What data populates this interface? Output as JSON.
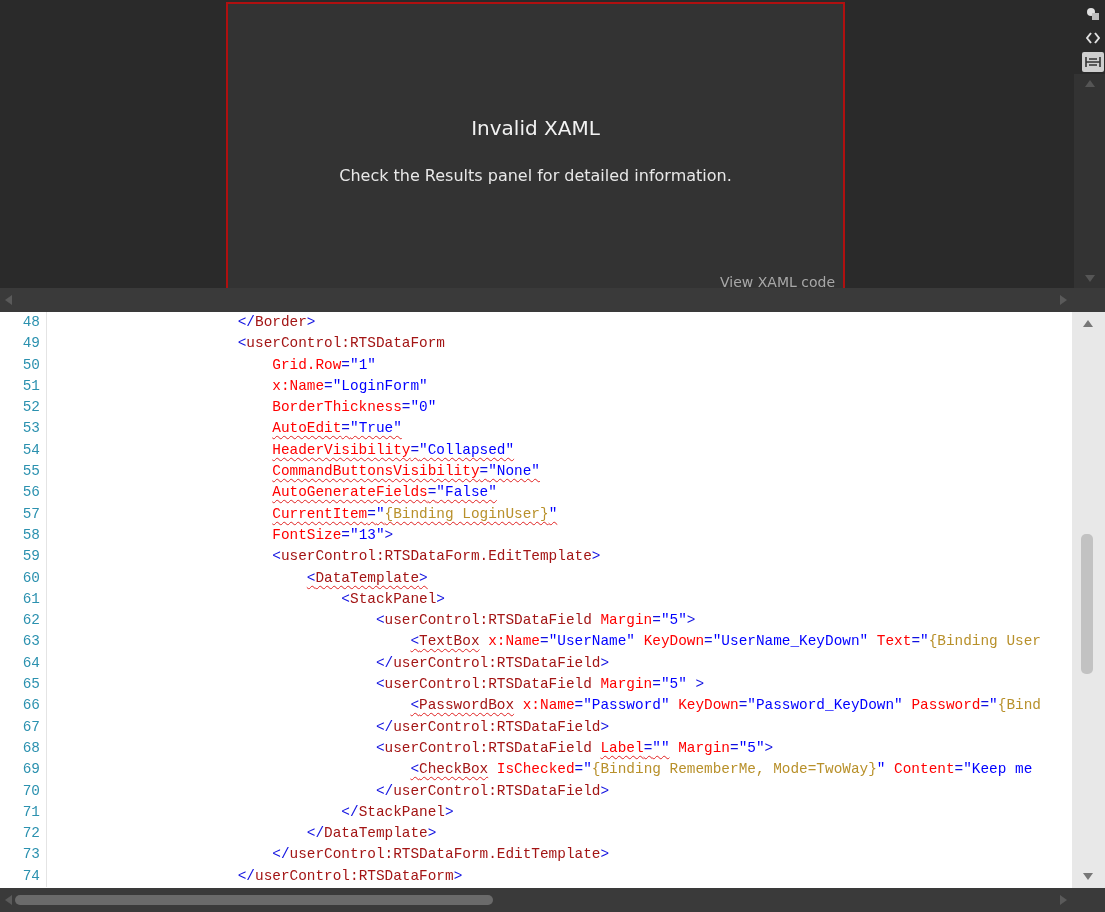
{
  "designer": {
    "title": "Invalid XAML",
    "detail": "Check the Results panel for detailed information.",
    "link": "View XAML code"
  },
  "toolbar": [
    {
      "kind": "layers",
      "selected": false
    },
    {
      "kind": "code",
      "selected": false
    },
    {
      "kind": "ruler",
      "selected": true
    }
  ],
  "editor": {
    "lines": [
      {
        "number": "48",
        "tokens": [
          {
            "kind": "punct",
            "text": "                    </",
            "error": false
          },
          {
            "kind": "element",
            "text": "Border",
            "error": false
          },
          {
            "kind": "punct",
            "text": ">",
            "error": false
          }
        ]
      },
      {
        "number": "49",
        "tokens": [
          {
            "kind": "punct",
            "text": "                    <",
            "error": false
          },
          {
            "kind": "element",
            "text": "userControl:RTSDataForm",
            "error": false
          }
        ]
      },
      {
        "number": "50",
        "tokens": [
          {
            "kind": "attribute",
            "text": "                        Grid.Row",
            "error": false
          },
          {
            "kind": "punct",
            "text": "=",
            "error": false
          },
          {
            "kind": "value",
            "text": "\"1\"",
            "error": false
          }
        ]
      },
      {
        "number": "51",
        "tokens": [
          {
            "kind": "attribute",
            "text": "                        x:Name",
            "error": false
          },
          {
            "kind": "punct",
            "text": "=",
            "error": false
          },
          {
            "kind": "value",
            "text": "\"LoginForm\"",
            "error": false
          }
        ]
      },
      {
        "number": "52",
        "tokens": [
          {
            "kind": "attribute",
            "text": "                        BorderThickness",
            "error": false
          },
          {
            "kind": "punct",
            "text": "=",
            "error": false
          },
          {
            "kind": "value",
            "text": "\"0\"",
            "error": false
          }
        ]
      },
      {
        "number": "53",
        "tokens": [
          {
            "kind": "attribute",
            "text": "                        AutoEdit",
            "error": true
          },
          {
            "kind": "punct",
            "text": "=",
            "error": true
          },
          {
            "kind": "value",
            "text": "\"True\"",
            "error": true
          }
        ]
      },
      {
        "number": "54",
        "tokens": [
          {
            "kind": "attribute",
            "text": "                        HeaderVisibility",
            "error": true
          },
          {
            "kind": "punct",
            "text": "=",
            "error": true
          },
          {
            "kind": "value",
            "text": "\"Collapsed\"",
            "error": true
          }
        ]
      },
      {
        "number": "55",
        "tokens": [
          {
            "kind": "attribute",
            "text": "                        CommandButtonsVisibility",
            "error": true
          },
          {
            "kind": "punct",
            "text": "=",
            "error": true
          },
          {
            "kind": "value",
            "text": "\"None\"",
            "error": true
          }
        ]
      },
      {
        "number": "56",
        "tokens": [
          {
            "kind": "attribute",
            "text": "                        AutoGenerateFields",
            "error": true
          },
          {
            "kind": "punct",
            "text": "=",
            "error": true
          },
          {
            "kind": "value",
            "text": "\"False\"",
            "error": true
          }
        ]
      },
      {
        "number": "57",
        "tokens": [
          {
            "kind": "attribute",
            "text": "                        CurrentItem",
            "error": true
          },
          {
            "kind": "punct",
            "text": "=",
            "error": true
          },
          {
            "kind": "value",
            "text": "\"",
            "error": true
          },
          {
            "kind": "binding",
            "text": "{Binding LoginUser}",
            "error": true
          },
          {
            "kind": "value",
            "text": "\"",
            "error": true
          }
        ]
      },
      {
        "number": "58",
        "tokens": [
          {
            "kind": "attribute",
            "text": "                        FontSize",
            "error": false
          },
          {
            "kind": "punct",
            "text": "=",
            "error": false
          },
          {
            "kind": "value",
            "text": "\"13\"",
            "error": false
          },
          {
            "kind": "punct",
            "text": ">",
            "error": false
          }
        ]
      },
      {
        "number": "59",
        "tokens": [
          {
            "kind": "punct",
            "text": "                        <",
            "error": false
          },
          {
            "kind": "element",
            "text": "userControl:RTSDataForm.EditTemplate",
            "error": false
          },
          {
            "kind": "punct",
            "text": ">",
            "error": false
          }
        ]
      },
      {
        "number": "60",
        "tokens": [
          {
            "kind": "punct",
            "text": "                            <",
            "error": true
          },
          {
            "kind": "element",
            "text": "DataTemplate",
            "error": true
          },
          {
            "kind": "punct",
            "text": ">",
            "error": true
          }
        ]
      },
      {
        "number": "61",
        "tokens": [
          {
            "kind": "punct",
            "text": "                                <",
            "error": false
          },
          {
            "kind": "element",
            "text": "StackPanel",
            "error": false
          },
          {
            "kind": "punct",
            "text": ">",
            "error": false
          }
        ]
      },
      {
        "number": "62",
        "tokens": [
          {
            "kind": "punct",
            "text": "                                    <",
            "error": false
          },
          {
            "kind": "element",
            "text": "userControl:RTSDataField",
            "error": false
          },
          {
            "kind": "attribute",
            "text": " Margin",
            "error": false
          },
          {
            "kind": "punct",
            "text": "=",
            "error": false
          },
          {
            "kind": "value",
            "text": "\"5\"",
            "error": false
          },
          {
            "kind": "punct",
            "text": ">",
            "error": false
          }
        ]
      },
      {
        "number": "63",
        "tokens": [
          {
            "kind": "punct",
            "text": "                                        <",
            "error": true
          },
          {
            "kind": "element",
            "text": "TextBox",
            "error": true
          },
          {
            "kind": "attribute",
            "text": " x:Name",
            "error": false
          },
          {
            "kind": "punct",
            "text": "=",
            "error": false
          },
          {
            "kind": "value",
            "text": "\"UserName\"",
            "error": false
          },
          {
            "kind": "attribute",
            "text": " KeyDown",
            "error": false
          },
          {
            "kind": "punct",
            "text": "=",
            "error": false
          },
          {
            "kind": "value",
            "text": "\"UserName_KeyDown\"",
            "error": false
          },
          {
            "kind": "attribute",
            "text": " Text",
            "error": false
          },
          {
            "kind": "punct",
            "text": "=",
            "error": false
          },
          {
            "kind": "value",
            "text": "\"",
            "error": false
          },
          {
            "kind": "binding",
            "text": "{Binding User",
            "error": false
          }
        ]
      },
      {
        "number": "64",
        "tokens": [
          {
            "kind": "punct",
            "text": "                                    </",
            "error": false
          },
          {
            "kind": "element",
            "text": "userControl:RTSDataField",
            "error": false
          },
          {
            "kind": "punct",
            "text": ">",
            "error": false
          }
        ]
      },
      {
        "number": "65",
        "tokens": [
          {
            "kind": "punct",
            "text": "                                    <",
            "error": false
          },
          {
            "kind": "element",
            "text": "userControl:RTSDataField",
            "error": false
          },
          {
            "kind": "attribute",
            "text": " Margin",
            "error": false
          },
          {
            "kind": "punct",
            "text": "=",
            "error": false
          },
          {
            "kind": "value",
            "text": "\"5\"",
            "error": false
          },
          {
            "kind": "punct",
            "text": " >",
            "error": false
          }
        ]
      },
      {
        "number": "66",
        "tokens": [
          {
            "kind": "punct",
            "text": "                                        <",
            "error": true
          },
          {
            "kind": "element",
            "text": "PasswordBox",
            "error": true
          },
          {
            "kind": "attribute",
            "text": " x:Name",
            "error": false
          },
          {
            "kind": "punct",
            "text": "=",
            "error": false
          },
          {
            "kind": "value",
            "text": "\"Password\"",
            "error": false
          },
          {
            "kind": "attribute",
            "text": " KeyDown",
            "error": false
          },
          {
            "kind": "punct",
            "text": "=",
            "error": false
          },
          {
            "kind": "value",
            "text": "\"Password_KeyDown\"",
            "error": false
          },
          {
            "kind": "attribute",
            "text": " Password",
            "error": false
          },
          {
            "kind": "punct",
            "text": "=",
            "error": false
          },
          {
            "kind": "value",
            "text": "\"",
            "error": false
          },
          {
            "kind": "binding",
            "text": "{Bind",
            "error": false
          }
        ]
      },
      {
        "number": "67",
        "tokens": [
          {
            "kind": "punct",
            "text": "                                    </",
            "error": false
          },
          {
            "kind": "element",
            "text": "userControl:RTSDataField",
            "error": false
          },
          {
            "kind": "punct",
            "text": ">",
            "error": false
          }
        ]
      },
      {
        "number": "68",
        "tokens": [
          {
            "kind": "punct",
            "text": "                                    <",
            "error": false
          },
          {
            "kind": "element",
            "text": "userControl:RTSDataField ",
            "error": false
          },
          {
            "kind": "attribute",
            "text": "Label",
            "error": true
          },
          {
            "kind": "punct",
            "text": "=",
            "error": true
          },
          {
            "kind": "value",
            "text": "\"\"",
            "error": true
          },
          {
            "kind": "attribute",
            "text": " Margin",
            "error": false
          },
          {
            "kind": "punct",
            "text": "=",
            "error": false
          },
          {
            "kind": "value",
            "text": "\"5\"",
            "error": false
          },
          {
            "kind": "punct",
            "text": ">",
            "error": false
          }
        ]
      },
      {
        "number": "69",
        "tokens": [
          {
            "kind": "punct",
            "text": "                                        <",
            "error": true
          },
          {
            "kind": "element",
            "text": "CheckBox",
            "error": true
          },
          {
            "kind": "attribute",
            "text": " IsChecked",
            "error": false
          },
          {
            "kind": "punct",
            "text": "=",
            "error": false
          },
          {
            "kind": "value",
            "text": "\"",
            "error": false
          },
          {
            "kind": "binding",
            "text": "{Binding RememberMe, Mode=TwoWay}",
            "error": false
          },
          {
            "kind": "value",
            "text": "\"",
            "error": false
          },
          {
            "kind": "attribute",
            "text": " Content",
            "error": false
          },
          {
            "kind": "punct",
            "text": "=",
            "error": false
          },
          {
            "kind": "value",
            "text": "\"Keep me",
            "error": false
          }
        ]
      },
      {
        "number": "70",
        "tokens": [
          {
            "kind": "punct",
            "text": "                                    </",
            "error": false
          },
          {
            "kind": "element",
            "text": "userControl:RTSDataField",
            "error": false
          },
          {
            "kind": "punct",
            "text": ">",
            "error": false
          }
        ]
      },
      {
        "number": "71",
        "tokens": [
          {
            "kind": "punct",
            "text": "                                </",
            "error": false
          },
          {
            "kind": "element",
            "text": "StackPanel",
            "error": false
          },
          {
            "kind": "punct",
            "text": ">",
            "error": false
          }
        ]
      },
      {
        "number": "72",
        "tokens": [
          {
            "kind": "punct",
            "text": "                            </",
            "error": false
          },
          {
            "kind": "element",
            "text": "DataTemplate",
            "error": false
          },
          {
            "kind": "punct",
            "text": ">",
            "error": false
          }
        ]
      },
      {
        "number": "73",
        "tokens": [
          {
            "kind": "punct",
            "text": "                        </",
            "error": false
          },
          {
            "kind": "element",
            "text": "userControl:RTSDataForm.EditTemplate",
            "error": false
          },
          {
            "kind": "punct",
            "text": ">",
            "error": false
          }
        ]
      },
      {
        "number": "74",
        "tokens": [
          {
            "kind": "punct",
            "text": "                    </",
            "error": false
          },
          {
            "kind": "element",
            "text": "userControl:RTSDataForm",
            "error": false
          },
          {
            "kind": "punct",
            "text": ">",
            "error": false
          }
        ]
      }
    ]
  }
}
